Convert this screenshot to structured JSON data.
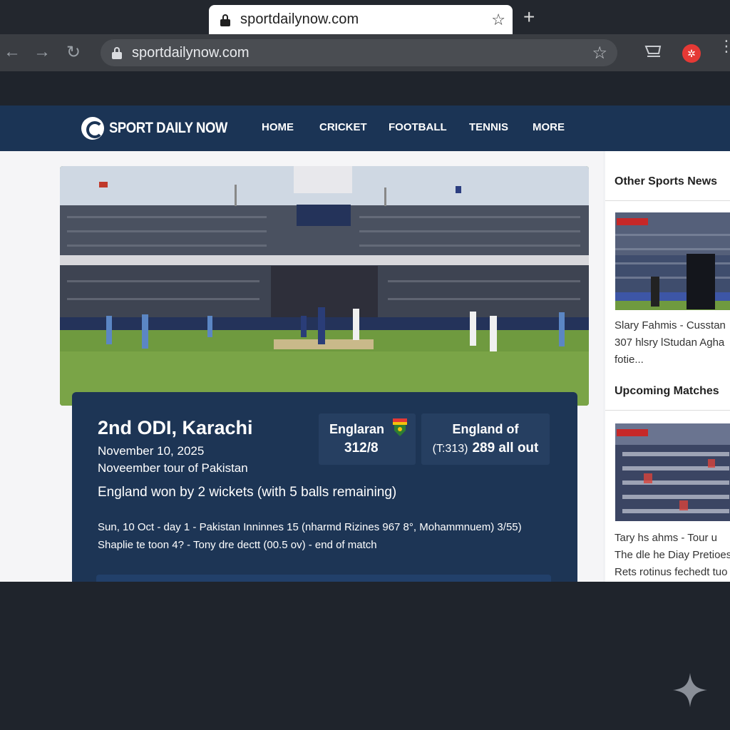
{
  "browser": {
    "tab_title": "sportdailynow.com",
    "url": "sportdailynow.com",
    "new_tab_symbol": "+",
    "back_symbol": "←",
    "forward_symbol": "→",
    "reload_symbol": "↻",
    "star_symbol": "☆",
    "menu_symbol": "⋮"
  },
  "site": {
    "logo_text": "SPORT DAILY NOW",
    "nav": [
      "HOME",
      "CRICKET",
      "FOOTBALL",
      "TENNIS",
      "MORE"
    ]
  },
  "match": {
    "title": "2nd ODI, Karachi",
    "date": "November 10, 2025",
    "tour": "Noveember tour of Pakistan",
    "team1_name": "Englaran",
    "team1_score": "312/8",
    "team2_name": "England of",
    "team2_target": "(T:313)",
    "team2_score": "289 all out",
    "result": "England won by 2 wickets (with 5 balls remaining)",
    "commentary_line1": "Sun, 10 Oct - day 1 - Pakistan Inninnes 15 (nharmd Rizines 967 8°, Mohammnuem) 3/55)",
    "commentary_line2": "Shaplie te toon 4? - Tony dre dectt (00.5 ov) - end of match"
  },
  "sidebar": {
    "heading_news": "Other Sports News",
    "news_line1": "Slary Fahmis - Cusstan",
    "news_line2": "307 hlsry lStudan Agha",
    "news_line3": "fotie...",
    "heading_upcoming": "Upcoming Matches",
    "upcoming_line1": "Tary hs ahms - Tour u",
    "upcoming_line2": "The dle he Diay Pretioes",
    "upcoming_line3": "Rets rotinus fechedt tuo"
  },
  "colors": {
    "header_bg": "#1b3455",
    "card_bg": "#1d3555",
    "chrome_bg": "#23272e",
    "page_bg": "#1f242c"
  },
  "icons": {
    "lock": "lock-icon",
    "star": "star-icon",
    "cart": "cart-icon",
    "extension": "extension-icon",
    "sparkle": "sparkle-icon"
  }
}
